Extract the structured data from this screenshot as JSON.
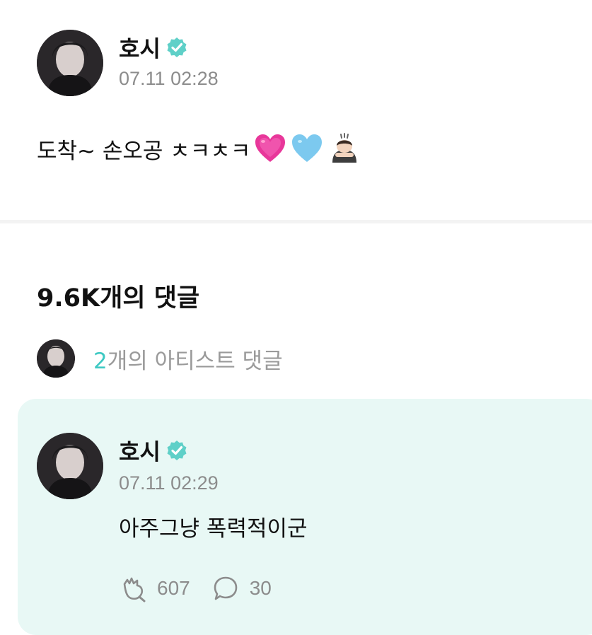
{
  "post": {
    "author": "호시",
    "timestamp": "07.11 02:28",
    "text": "도착~ 손오공 ㅊㅋㅊㅋ",
    "emojis": [
      "growing-heart-icon",
      "light-blue-heart-icon",
      "bowing-person-icon"
    ]
  },
  "comments": {
    "count_label": "9.6K개의 댓글",
    "artist_count": "2",
    "artist_label": "개의 아티스트 댓글"
  },
  "artist_comment": {
    "author": "호시",
    "timestamp": "07.11 02:29",
    "text": "아주그냥 폭력적이군",
    "likes": "607",
    "replies": "30"
  },
  "colors": {
    "verified": "#5fd0c8",
    "accent": "#3ec9c3",
    "card_bg": "#e8f8f5",
    "muted_text": "#8c8c8c"
  }
}
